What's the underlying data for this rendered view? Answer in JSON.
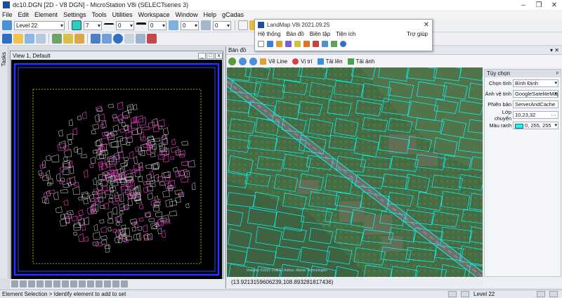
{
  "window": {
    "title": "dc10.DGN [2D - V8 DGN] - MicroStation V8i (SELECTseries 3)"
  },
  "menu": [
    "File",
    "Edit",
    "Element",
    "Settings",
    "Tools",
    "Utilities",
    "Workspace",
    "Window",
    "Help",
    "gCadas"
  ],
  "attributes": {
    "level": "Level 22",
    "color": "7",
    "style": "0",
    "weight": "0",
    "transparency": "0",
    "priority": "0"
  },
  "view1": {
    "title": "View 1, Default"
  },
  "lefttab": "Tasks",
  "landmap": {
    "title": "LandMap V8i 2021.09.25",
    "menu": [
      "Hệ thống",
      "Bản đồ",
      "Biên tập",
      "Tiện ích"
    ],
    "help": "Trợ giúp"
  },
  "map": {
    "panel_title": "Bản đồ",
    "toolbar": {
      "ve_line": "Vẽ Line",
      "vi_tri": "Vị trí",
      "tai_len": "Tải lên",
      "tai_anh": "Tải ảnh"
    },
    "coords": "(13.9213159606239,108.893281817436)"
  },
  "options": {
    "title": "Tùy chọn",
    "rows": [
      {
        "label": "Chọn tỉnh",
        "value": "Bình Định"
      },
      {
        "label": "Ảnh vệ tinh",
        "value": "GoogleSateliteMap"
      },
      {
        "label": "Phiên bản",
        "value": "ServerAndCache"
      },
      {
        "label": "Lớp chuyển",
        "value": "10,23,32"
      },
      {
        "label": "Màu ranh",
        "value": "0, 255, 255"
      }
    ]
  },
  "status": {
    "message": "Element Selection > Identify element to add to set",
    "level": "Level 22"
  },
  "colors": {
    "accent": "#1c4f9c",
    "parcel": "#00ffff",
    "road": "#6b6b6b"
  }
}
